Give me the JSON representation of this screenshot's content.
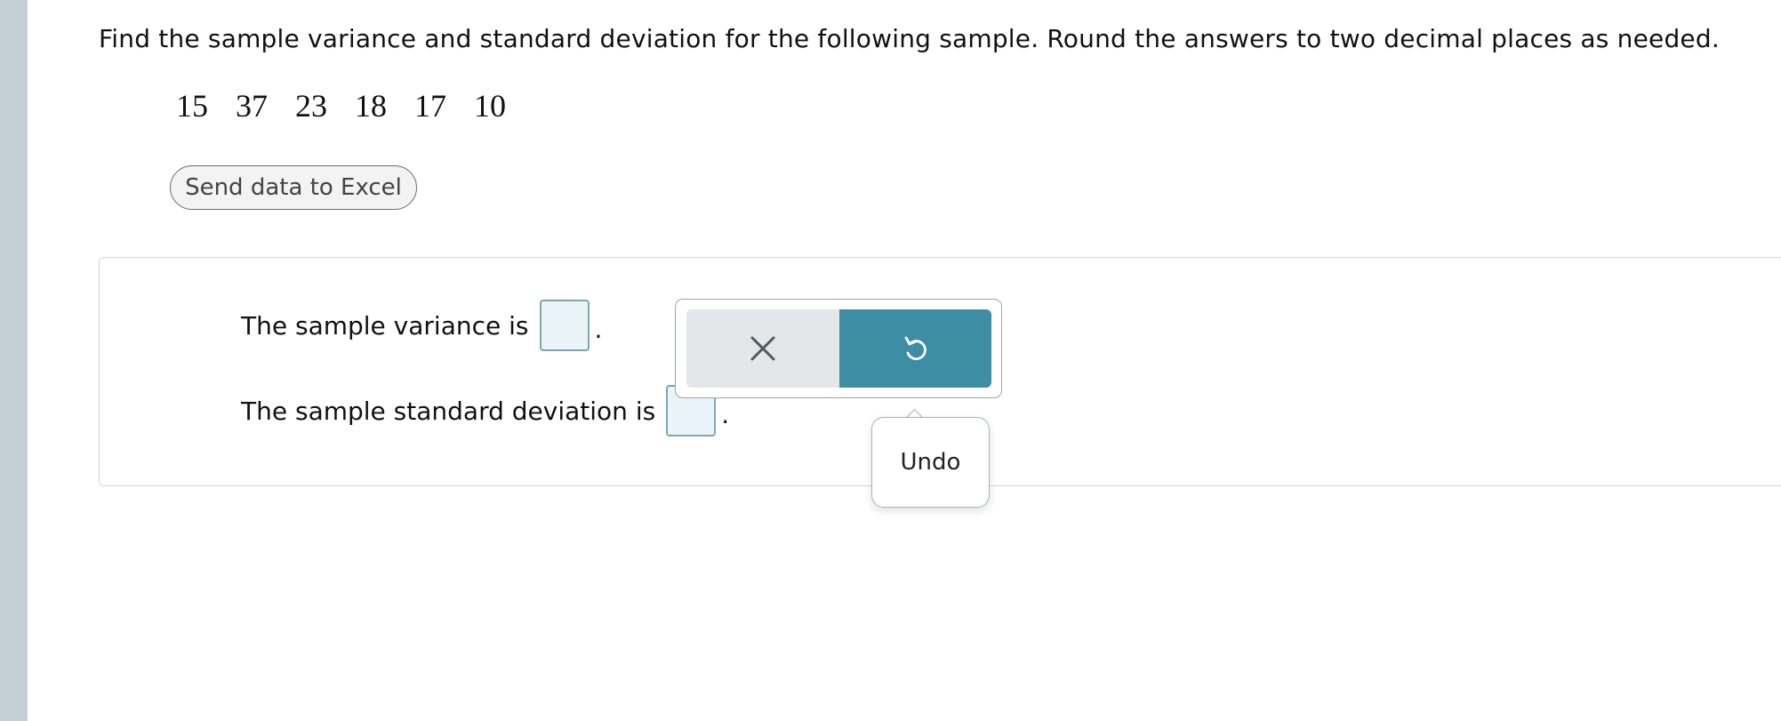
{
  "question": {
    "text": "Find the sample variance and standard deviation for the following sample. Round the answers to two decimal places as needed."
  },
  "sample": {
    "values": [
      "15",
      "37",
      "23",
      "18",
      "17",
      "10"
    ]
  },
  "buttons": {
    "send_to_excel": "Send data to Excel"
  },
  "answers": {
    "variance_label": "The sample variance is",
    "variance_value": "",
    "std_dev_label": "The sample standard deviation is",
    "std_dev_value": "",
    "period": "."
  },
  "toolbar": {
    "clear_icon": "close-icon",
    "undo_icon": "undo-icon",
    "undo_color": "#3d8da5"
  },
  "tooltip": {
    "text": "Undo"
  },
  "colors": {
    "left_rail": "#c5d0d6",
    "input_box": "#eaf3f8",
    "accent": "#3d8da5"
  }
}
